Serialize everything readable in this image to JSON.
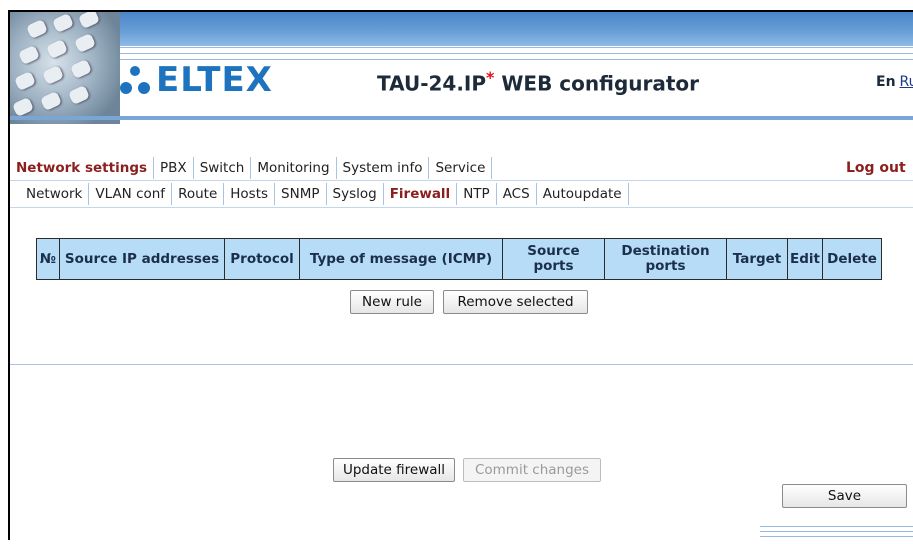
{
  "header": {
    "logo_text": "ELTEX",
    "title_main": "TAU-24.IP",
    "title_star": "*",
    "title_rest": " WEB configurator",
    "lang_en": "En",
    "lang_ru": "Ru"
  },
  "nav_main": {
    "items": [
      "Network settings",
      "PBX",
      "Switch",
      "Monitoring",
      "System info",
      "Service"
    ],
    "active": "Network settings",
    "logout": "Log out"
  },
  "nav_sub": {
    "items": [
      "Network",
      "VLAN conf",
      "Route",
      "Hosts",
      "SNMP",
      "Syslog",
      "Firewall",
      "NTP",
      "ACS",
      "Autoupdate"
    ],
    "active": "Firewall"
  },
  "table": {
    "headers": [
      "№",
      "Source IP addresses",
      "Protocol",
      "Type of message (ICMP)",
      "Source ports",
      "Destination ports",
      "Target",
      "Edit",
      "Delete"
    ]
  },
  "buttons": {
    "new_rule": "New rule",
    "remove_selected": "Remove selected",
    "update_firewall": "Update firewall",
    "commit_changes": "Commit changes",
    "save": "Save"
  },
  "colors": {
    "accent": "#1e73be",
    "active_tab": "#8b1f1f",
    "table_header": "#b7dcf7"
  }
}
